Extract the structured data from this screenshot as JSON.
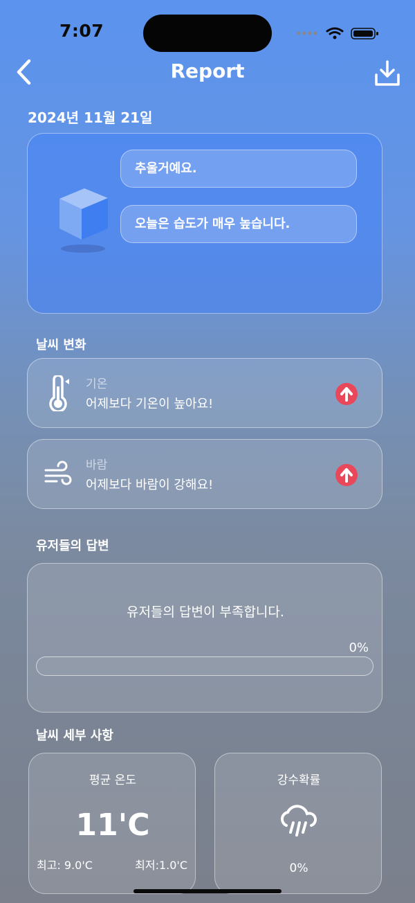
{
  "status": {
    "time": "7:07"
  },
  "header": {
    "title": "Report"
  },
  "date": "2024년 11월 21일",
  "hero": {
    "messages": [
      "추울거예요.",
      "오늘은 습도가 매우 높습니다."
    ]
  },
  "weather_change": {
    "heading": "날씨 변화",
    "items": [
      {
        "icon": "thermometer-icon",
        "label": "기온",
        "text": "어제보다 기온이 높아요!",
        "trend": "up"
      },
      {
        "icon": "wind-icon",
        "label": "바람",
        "text": "어제보다 바람이 강해요!",
        "trend": "up"
      }
    ]
  },
  "answers": {
    "heading": "유저들의 답변",
    "message": "유저들의 답변이 부족합니다.",
    "percent_label": "0%",
    "progress": 0
  },
  "details": {
    "heading": "날씨 세부 사항",
    "avg_temp": {
      "title": "평균 온도",
      "value": "11'C",
      "max": "최고: 9.0'C",
      "min": "최저:1.0'C"
    },
    "precip": {
      "title": "강수확률",
      "value": "0%",
      "icon": "rain-cloud-icon"
    }
  },
  "colors": {
    "trend_up": "#e8485a",
    "hero_accent": "#4a84f5"
  }
}
